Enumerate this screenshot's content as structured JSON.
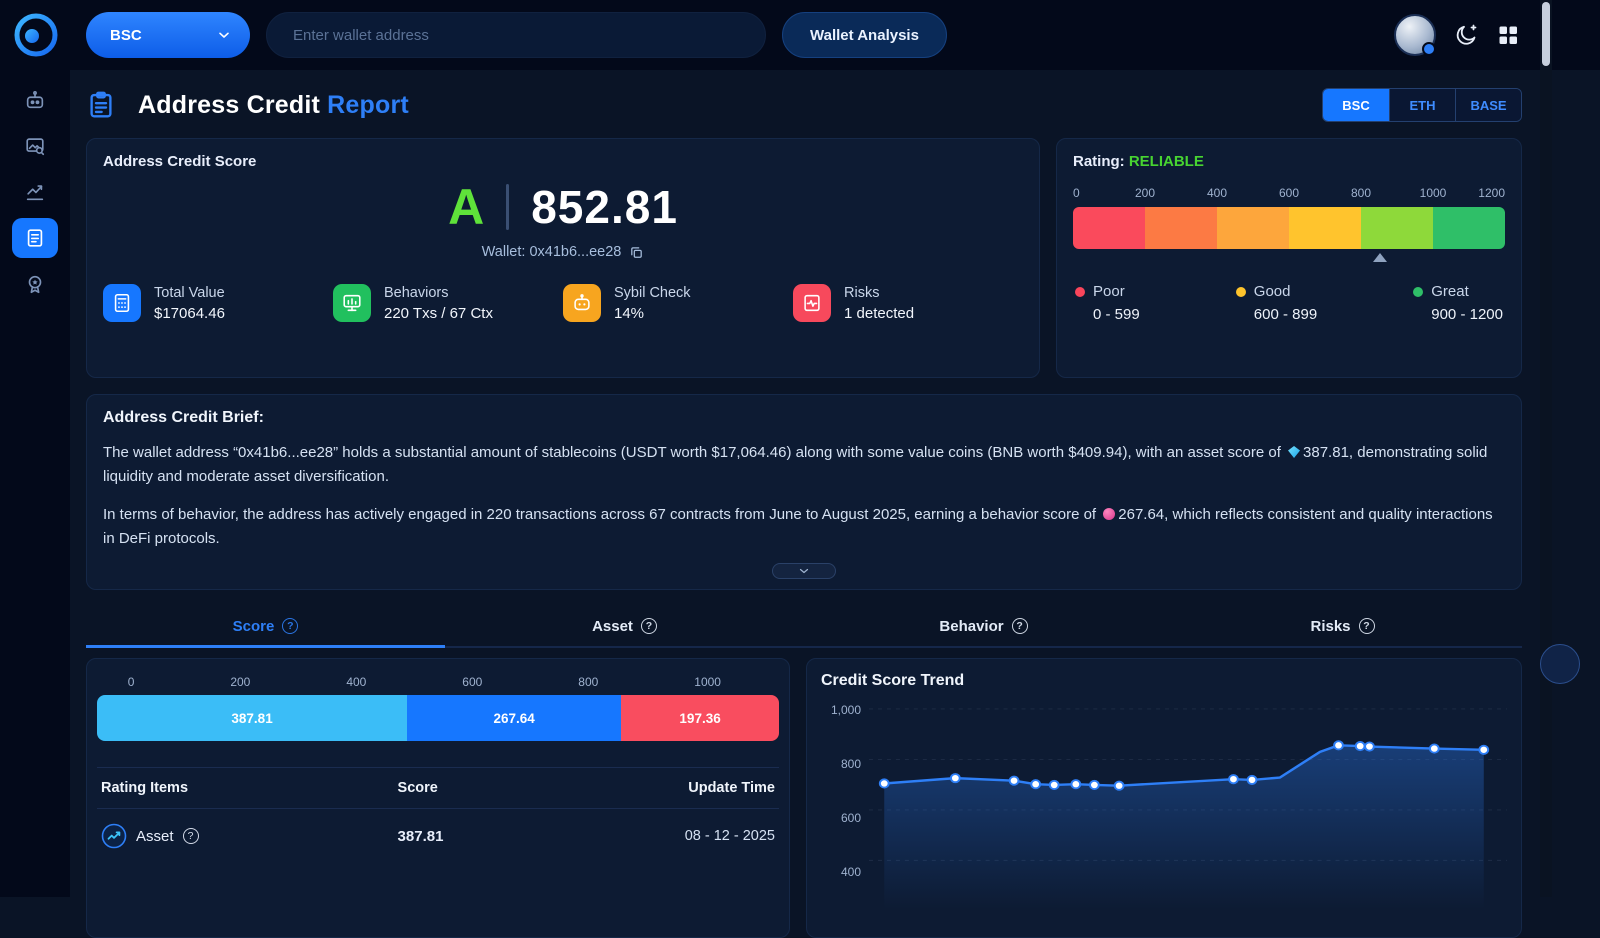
{
  "topbar": {
    "network_selector": {
      "label": "BSC"
    },
    "search_placeholder": "Enter wallet address",
    "analyze_button_label": "Wallet Analysis"
  },
  "sidebar": {
    "icons": [
      "agent-icon",
      "image-scan-icon",
      "chart-up-icon",
      "report-icon",
      "badge-icon"
    ],
    "active": "report-icon"
  },
  "header": {
    "title_main": "Address Credit",
    "title_accent": "Report",
    "networks": [
      "BSC",
      "ETH",
      "BASE"
    ],
    "active_network": "BSC"
  },
  "score_card": {
    "title": "Address Credit Score",
    "grade": "A",
    "grade_color": "#5fe23a",
    "score": "852.81",
    "wallet_label": "Wallet: 0x41b6...ee28",
    "metrics": [
      {
        "label": "Total Value",
        "value": "$17064.46",
        "icon": "calculator-icon",
        "color": "#1677ff"
      },
      {
        "label": "Behaviors",
        "value": "220 Txs / 67 Ctx",
        "icon": "monitor-chart-icon",
        "color": "#21c05e"
      },
      {
        "label": "Sybil Check",
        "value": "14%",
        "icon": "bot-icon",
        "color": "#f7a51f"
      },
      {
        "label": "Risks",
        "value": "1 detected",
        "icon": "pulse-doc-icon",
        "color": "#f7495c"
      }
    ]
  },
  "rating_card": {
    "title_label": "Rating:",
    "rating": "RELIABLE",
    "rating_color": "#47d431",
    "scale_ticks": [
      "0",
      "200",
      "400",
      "600",
      "800",
      "1000",
      "1200"
    ],
    "segment_colors": [
      "#fa4a5c",
      "#fc7a44",
      "#fda63c",
      "#ffc42d",
      "#8ed93a",
      "#2fbf68"
    ],
    "marker_value": 852.81,
    "scale_max": 1200,
    "legend": [
      {
        "label": "Poor",
        "range": "0 - 599",
        "color": "#f9455b"
      },
      {
        "label": "Good",
        "range": "600 - 899",
        "color": "#fec42c"
      },
      {
        "label": "Great",
        "range": "900 - 1200",
        "color": "#2fbf68"
      }
    ]
  },
  "brief": {
    "title": "Address Credit Brief:",
    "paragraphs": [
      {
        "before": "The wallet address “0x41b6...ee28” holds a substantial amount of stablecoins (USDT worth $17,064.46) along with some value coins (BNB worth $409.94), with an asset score of ",
        "icon": "diamond-icon",
        "score": "387.81",
        "after": ", demonstrating solid liquidity and moderate asset diversification."
      },
      {
        "before": "In terms of behavior, the address has actively engaged in 220 transactions across 67 contracts from June to August 2025, earning a behavior score of ",
        "icon": "behavior-dot-icon",
        "score": "267.64",
        "after": ", which reflects consistent and quality interactions in DeFi protocols."
      }
    ]
  },
  "tabs": {
    "items": [
      {
        "label": "Score"
      },
      {
        "label": "Asset"
      },
      {
        "label": "Behavior"
      },
      {
        "label": "Risks"
      }
    ],
    "active": "Score"
  },
  "score_panel": {
    "scale_ticks": [
      "0",
      "200",
      "400",
      "600",
      "800",
      "1000"
    ],
    "bar_segments": [
      {
        "label": "387.81",
        "value": 387.81,
        "color": "#3bbdf7"
      },
      {
        "label": "267.64",
        "value": 267.64,
        "color": "#1677ff"
      },
      {
        "label": "197.36",
        "value": 197.36,
        "color": "#f94d5f"
      }
    ],
    "table": {
      "headers": [
        "Rating Items",
        "Score",
        "Update Time"
      ],
      "rows": [
        {
          "item": "Asset",
          "score": "387.81",
          "update_time": "08 - 12 - 2025"
        }
      ]
    }
  },
  "chart_data": {
    "type": "line",
    "title": "Credit Score Trend",
    "series_name": "Credit Score",
    "ylim": [
      400,
      1000
    ],
    "ytick_values": [
      1000,
      800,
      600,
      400
    ],
    "ytick_labels": [
      "1,000",
      "800",
      "600",
      "400"
    ],
    "gridline_values": [
      1000,
      800,
      600,
      400
    ],
    "grid": "horizontal-dashed",
    "legend_position": "none",
    "line_color": "#2e7ff7",
    "dot_color": "#ffffff",
    "points": [
      {
        "x": 0.015,
        "value": 705
      },
      {
        "x": 0.13,
        "value": 726
      },
      {
        "x": 0.225,
        "value": 716
      },
      {
        "x": 0.26,
        "value": 702
      },
      {
        "x": 0.29,
        "value": 699
      },
      {
        "x": 0.325,
        "value": 702
      },
      {
        "x": 0.355,
        "value": 699
      },
      {
        "x": 0.395,
        "value": 696
      },
      {
        "x": 0.58,
        "value": 722
      },
      {
        "x": 0.61,
        "value": 719
      },
      {
        "x": 0.655,
        "value": 728,
        "dot": false
      },
      {
        "x": 0.72,
        "value": 830,
        "dot": false
      },
      {
        "x": 0.75,
        "value": 856
      },
      {
        "x": 0.785,
        "value": 853
      },
      {
        "x": 0.8,
        "value": 851
      },
      {
        "x": 0.905,
        "value": 843
      },
      {
        "x": 0.985,
        "value": 838
      }
    ]
  }
}
